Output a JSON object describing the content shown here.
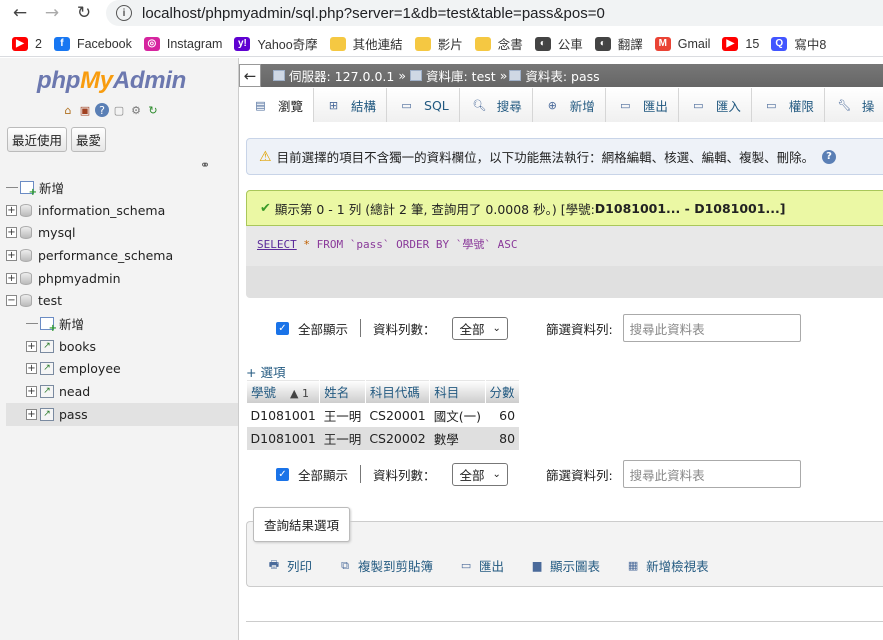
{
  "browser": {
    "url": "localhost/phpmyadmin/sql.php?server=1&db=test&table=pass&pos=0",
    "bookmarks": [
      {
        "label": "2",
        "icon": "youtube-icon",
        "color": "#ff0000"
      },
      {
        "label": "Facebook",
        "icon": "facebook-icon",
        "color": "#1877f2"
      },
      {
        "label": "Instagram",
        "icon": "instagram-icon",
        "color": "#d6249f"
      },
      {
        "label": "Yahoo奇摩",
        "icon": "yahoo-icon",
        "color": "#5f01d1"
      },
      {
        "label": "其他連結",
        "icon": "folder-icon",
        "color": "#f5c842"
      },
      {
        "label": "影片",
        "icon": "folder-icon",
        "color": "#f5c842"
      },
      {
        "label": "念書",
        "icon": "folder-icon",
        "color": "#f5c842"
      },
      {
        "label": "公車",
        "icon": "globe-icon",
        "color": "#444444"
      },
      {
        "label": "翻譯",
        "icon": "globe-icon",
        "color": "#444444"
      },
      {
        "label": "Gmail",
        "icon": "gmail-icon",
        "color": "#ea4335"
      },
      {
        "label": "15",
        "icon": "youtube-icon",
        "color": "#ff0000"
      },
      {
        "label": "寫中8",
        "icon": "quizlet-icon",
        "color": "#4255ff"
      }
    ]
  },
  "nav": {
    "logo_php": "php",
    "logo_my": "My",
    "logo_admin": "Admin",
    "tabs": [
      "最近使用",
      "最愛"
    ],
    "tree": [
      {
        "label": "新增",
        "type": "new",
        "level": 0
      },
      {
        "label": "information_schema",
        "type": "db",
        "level": 0
      },
      {
        "label": "mysql",
        "type": "db",
        "level": 0
      },
      {
        "label": "performance_schema",
        "type": "db",
        "level": 0
      },
      {
        "label": "phpmyadmin",
        "type": "db",
        "level": 0
      },
      {
        "label": "test",
        "type": "db-open",
        "level": 0
      },
      {
        "label": "新增",
        "type": "new",
        "level": 1
      },
      {
        "label": "books",
        "type": "table",
        "level": 1
      },
      {
        "label": "employee",
        "type": "table",
        "level": 1
      },
      {
        "label": "nead",
        "type": "table",
        "level": 1
      },
      {
        "label": "pass",
        "type": "table",
        "level": 1,
        "selected": true
      }
    ]
  },
  "breadcrumb": {
    "server": "伺服器: 127.0.0.1",
    "database": "資料庫: test",
    "table": "資料表: pass"
  },
  "tabs": [
    {
      "label": "瀏覽",
      "icon": "browse-icon",
      "active": true
    },
    {
      "label": "結構",
      "icon": "structure-icon"
    },
    {
      "label": "SQL",
      "icon": "sql-icon"
    },
    {
      "label": "搜尋",
      "icon": "search-icon"
    },
    {
      "label": "新增",
      "icon": "insert-icon"
    },
    {
      "label": "匯出",
      "icon": "export-icon"
    },
    {
      "label": "匯入",
      "icon": "import-icon"
    },
    {
      "label": "權限",
      "icon": "privileges-icon"
    },
    {
      "label": "操",
      "icon": "wrench-icon"
    }
  ],
  "warning": "目前選擇的項目不含獨一的資料欄位，以下功能無法執行：網格編輯、核選、編輯、複製、刪除。",
  "success": {
    "text": "顯示第 0 - 1 列 (總計 2 筆, 查詢用了 0.0008 秒。) [學號: ",
    "range": "D1081001... - D1081001...",
    "close": "]"
  },
  "sql": {
    "select": "SELECT",
    "star": "*",
    "from": "FROM",
    "table": "`pass`",
    "order": "ORDER BY",
    "col": "`學號`",
    "dir": "ASC"
  },
  "controls": {
    "show_all": "全部顯示",
    "rows_label": "資料列數：",
    "rows_value": "全部",
    "filter_label": "篩選資料列:",
    "filter_placeholder": "搜尋此資料表"
  },
  "options_link": "+ 選項",
  "table": {
    "headers": [
      "學號",
      "姓名",
      "科目代碼",
      "科目",
      "分數"
    ],
    "sort_marker": "▲ 1",
    "rows": [
      [
        "D1081001",
        "王一明",
        "CS20001",
        "國文(一)",
        "60"
      ],
      [
        "D1081001",
        "王一明",
        "CS20002",
        "數學",
        "80"
      ]
    ]
  },
  "query_results": {
    "legend": "查詢結果選項",
    "actions": [
      {
        "label": "列印",
        "icon": "print-icon"
      },
      {
        "label": "複製到剪貼簿",
        "icon": "copy-icon"
      },
      {
        "label": "匯出",
        "icon": "export-icon"
      },
      {
        "label": "顯示圖表",
        "icon": "chart-icon"
      },
      {
        "label": "新增檢視表",
        "icon": "view-icon"
      }
    ]
  }
}
